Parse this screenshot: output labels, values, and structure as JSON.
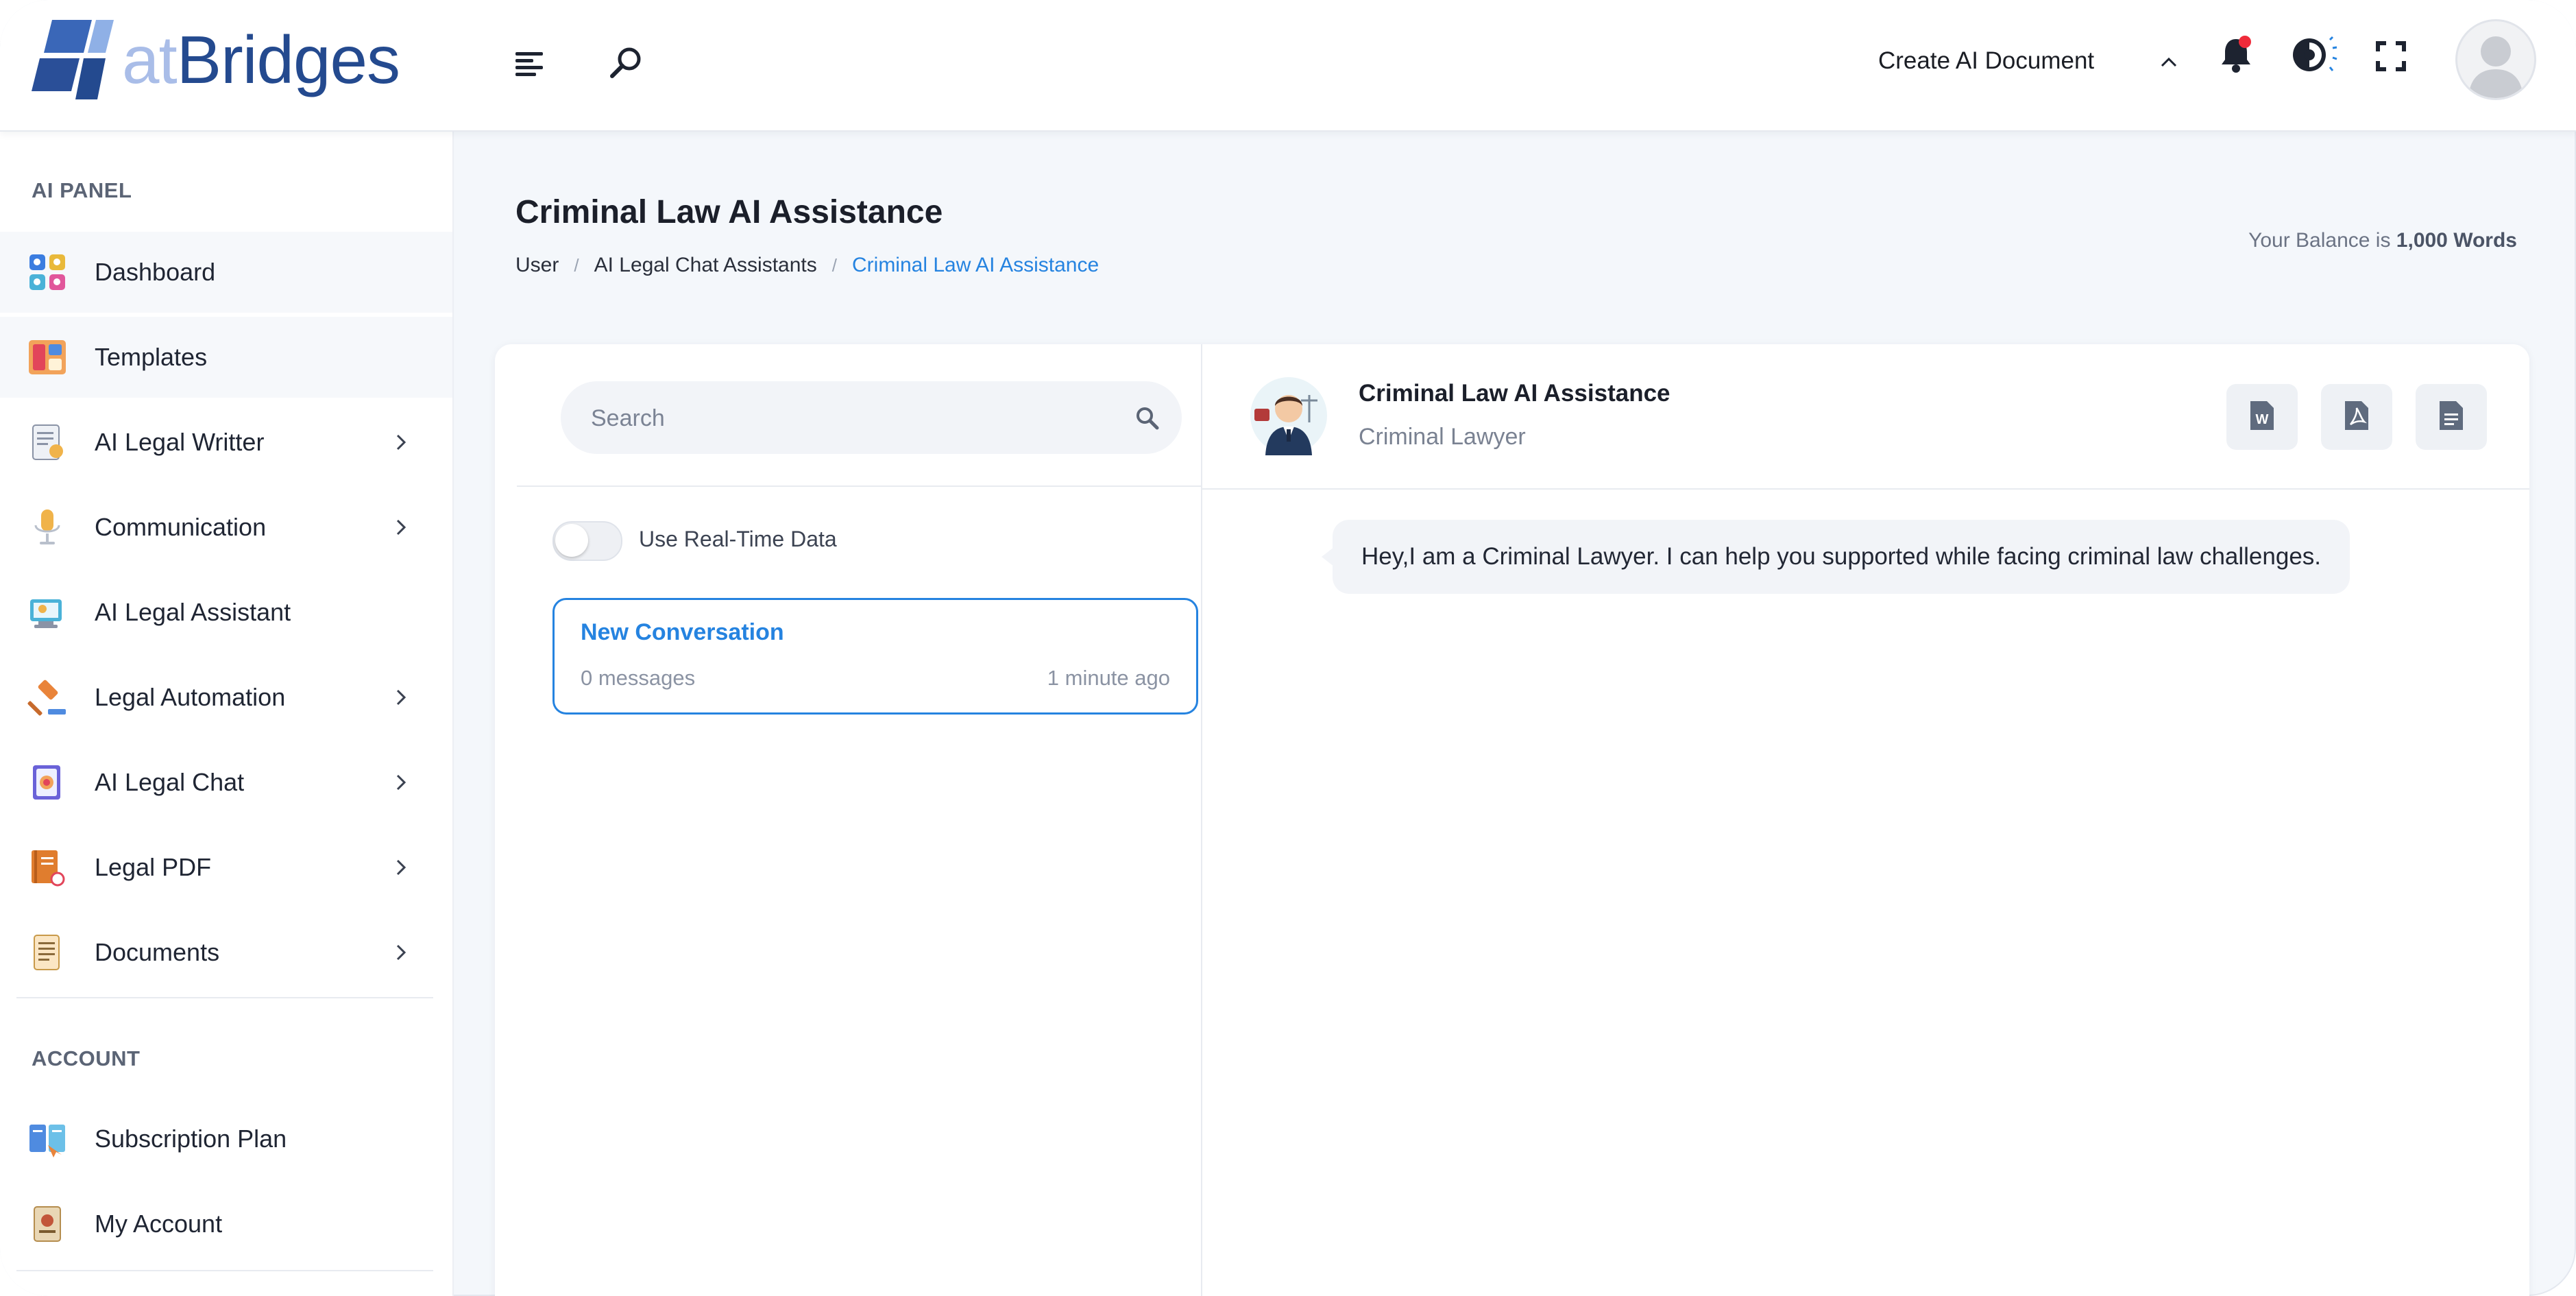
{
  "header": {
    "logo": {
      "prefix": "at",
      "name": "Bridges"
    },
    "create_doc_label": "Create AI Document",
    "icons": {
      "menu": "hamburger-icon",
      "search": "search-icon",
      "caret": "chevron-up-icon",
      "notifications": "bell-icon",
      "theme": "theme-toggle-icon",
      "fullscreen": "fullscreen-icon"
    },
    "has_notification": true
  },
  "sidebar": {
    "ai_panel_title": "AI PANEL",
    "ai_items": [
      {
        "label": "Dashboard",
        "icon": "dashboard-icon",
        "has_submenu": false
      },
      {
        "label": "Templates",
        "icon": "templates-icon",
        "has_submenu": false
      },
      {
        "label": "AI Legal Writter",
        "icon": "legal-writer-icon",
        "has_submenu": true
      },
      {
        "label": "Communication",
        "icon": "microphone-icon",
        "has_submenu": true
      },
      {
        "label": "AI Legal Assistant",
        "icon": "legal-assistant-icon",
        "has_submenu": false
      },
      {
        "label": "Legal Automation",
        "icon": "gavel-icon",
        "has_submenu": true
      },
      {
        "label": "AI Legal Chat",
        "icon": "legal-chat-icon",
        "has_submenu": true
      },
      {
        "label": "Legal PDF",
        "icon": "pdf-book-icon",
        "has_submenu": true
      },
      {
        "label": "Documents",
        "icon": "documents-icon",
        "has_submenu": true
      }
    ],
    "account_title": "ACCOUNT",
    "account_items": [
      {
        "label": "Subscription Plan",
        "icon": "subscription-icon"
      },
      {
        "label": "My Account",
        "icon": "account-icon"
      }
    ]
  },
  "page": {
    "title": "Criminal Law AI Assistance",
    "breadcrumb": [
      "User",
      "AI Legal Chat Assistants",
      "Criminal Law AI Assistance"
    ],
    "balance_prefix": "Your Balance is",
    "balance_value": "1,000 Words"
  },
  "conversations": {
    "search_placeholder": "Search",
    "realtime_label": "Use Real-Time Data",
    "realtime_enabled": false,
    "items": [
      {
        "title": "New Conversation",
        "count": "0 messages",
        "time": "1 minute ago"
      }
    ]
  },
  "chat": {
    "assistant_name": "Criminal Law AI Assistance",
    "assistant_role": "Criminal Lawyer",
    "export_buttons": [
      {
        "icon": "word-file-icon"
      },
      {
        "icon": "pdf-file-icon"
      },
      {
        "icon": "text-file-icon"
      }
    ],
    "messages": [
      {
        "text": "Hey,I am a Criminal Lawyer. I can help you supported while facing criminal law challenges."
      }
    ]
  },
  "colors": {
    "accent": "#2583e0",
    "logo_light": "#a9bde8",
    "logo_dark": "#244a8f",
    "notification_dot": "#ef2b3a"
  }
}
